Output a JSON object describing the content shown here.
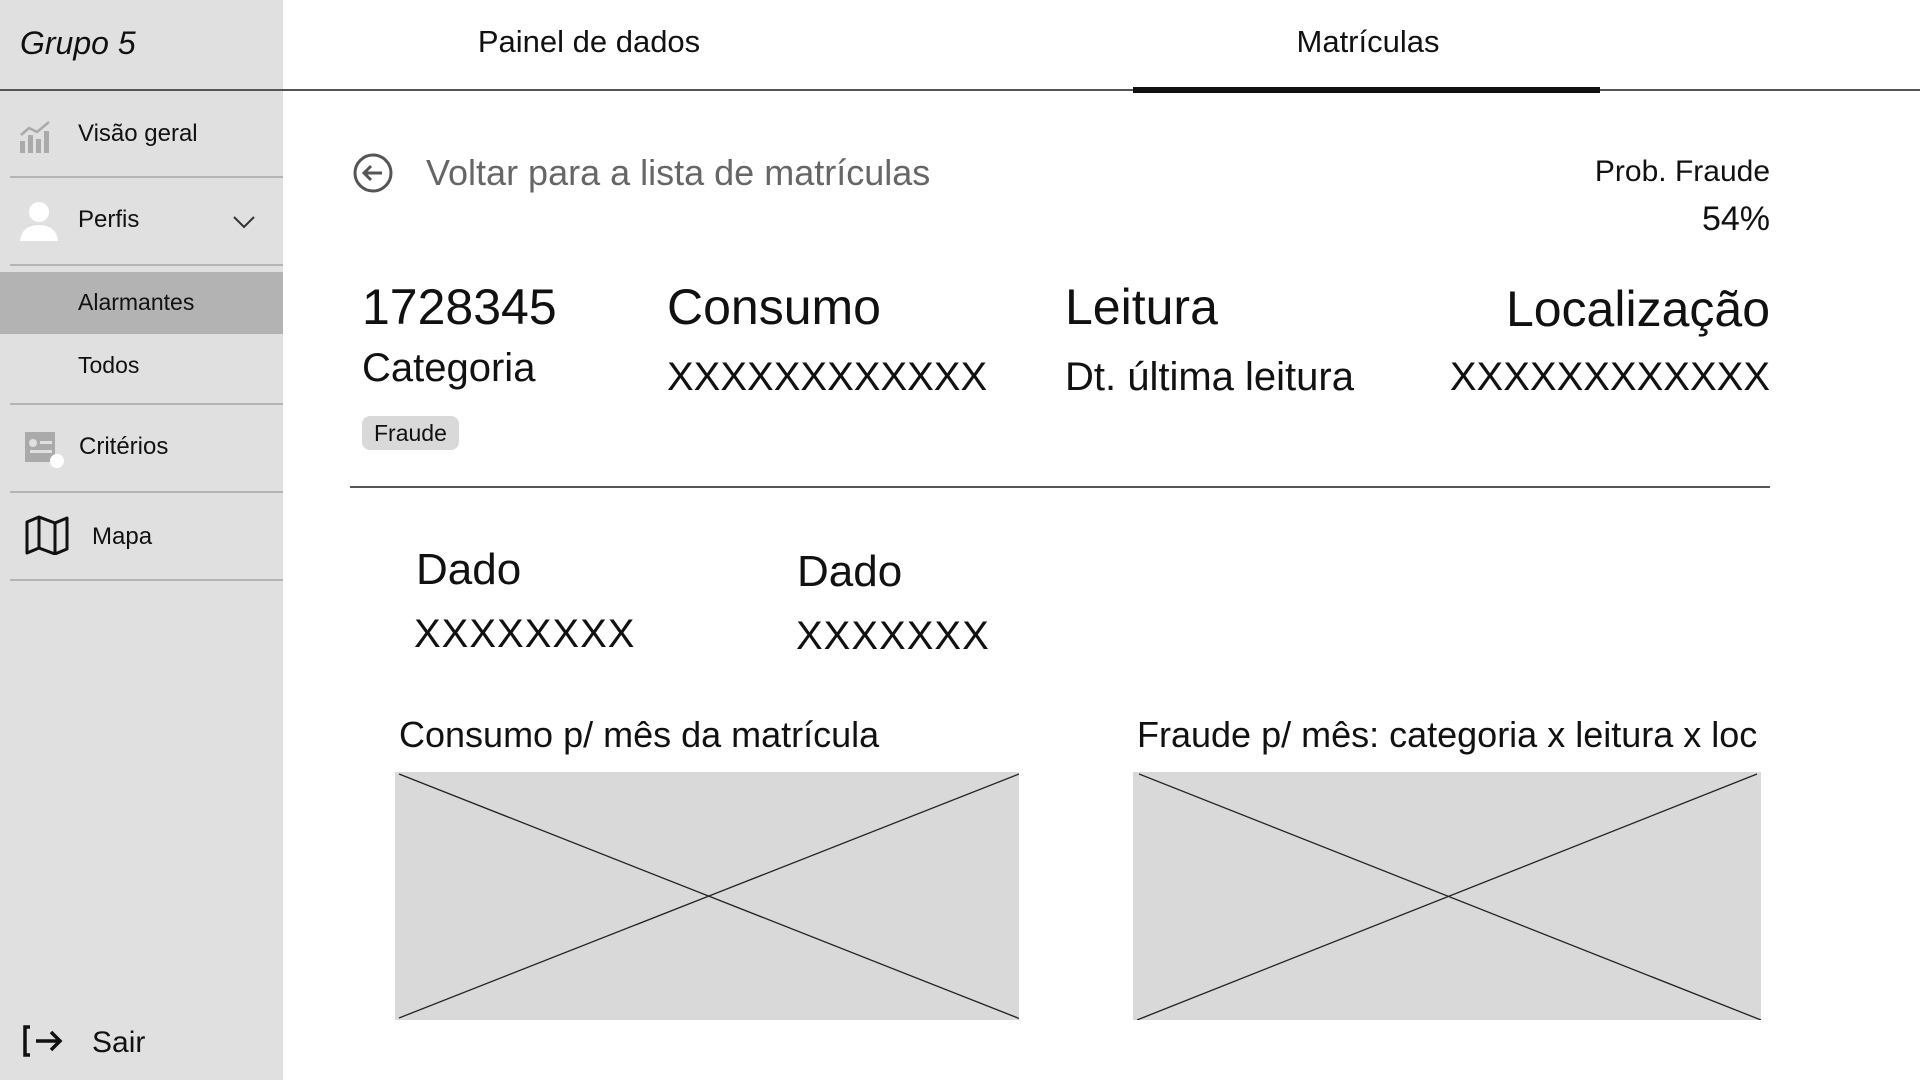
{
  "app": {
    "brand": "Grupo 5"
  },
  "tabs": [
    {
      "label": "Painel de dados"
    },
    {
      "label": "Matrículas"
    }
  ],
  "sidebar": {
    "items": [
      {
        "label": "Visão geral",
        "icon": "chart-icon"
      },
      {
        "label": "Perfis",
        "icon": "person-icon"
      },
      {
        "label": "Alarmantes"
      },
      {
        "label": "Todos"
      },
      {
        "label": "Critérios",
        "icon": "criteria-icon"
      },
      {
        "label": "Mapa",
        "icon": "map-icon"
      }
    ],
    "logout": "Sair"
  },
  "detail": {
    "back": "Voltar para a lista de matrículas",
    "prob_label": "Prob. Fraude",
    "prob_value": "54%",
    "id": "1728345",
    "category_label": "Categoria",
    "badge": "Fraude",
    "consumo_label": "Consumo",
    "consumo_value": "XXXXXXXXXXXX",
    "leitura_label": "Leitura",
    "leitura_value": "Dt. última leitura",
    "localizacao_label": "Localização",
    "localizacao_value": "XXXXXXXXXXXX"
  },
  "data_fields": [
    {
      "label": "Dado",
      "value": "XXXXXXXX"
    },
    {
      "label": "Dado",
      "value": "XXXXXXX"
    }
  ],
  "charts": [
    {
      "title": "Consumo p/ mês da matrícula"
    },
    {
      "title": "Fraude p/ mês: categoria x leitura x loc"
    }
  ]
}
